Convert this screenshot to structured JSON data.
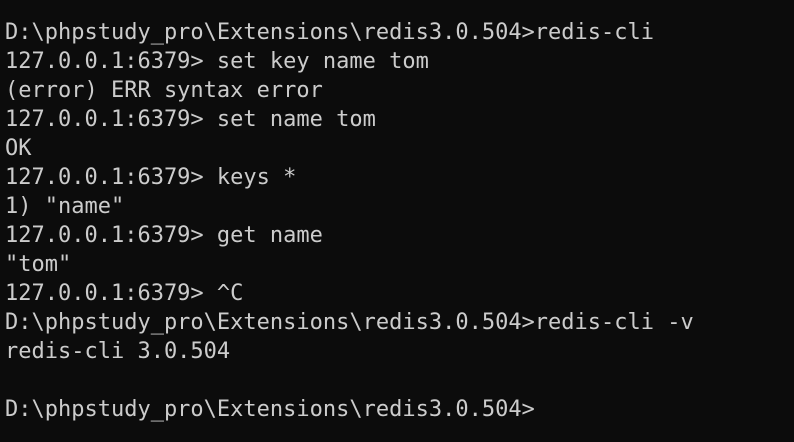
{
  "terminal": {
    "lines": [
      "D:\\phpstudy_pro\\Extensions\\redis3.0.504>redis-cli",
      "127.0.0.1:6379> set key name tom",
      "(error) ERR syntax error",
      "127.0.0.1:6379> set name tom",
      "OK",
      "127.0.0.1:6379> keys *",
      "1) \"name\"",
      "127.0.0.1:6379> get name",
      "\"tom\"",
      "127.0.0.1:6379> ^C",
      "D:\\phpstudy_pro\\Extensions\\redis3.0.504>redis-cli -v",
      "redis-cli 3.0.504",
      "",
      "D:\\phpstudy_pro\\Extensions\\redis3.0.504>"
    ]
  },
  "colors": {
    "background": "#0c0c0c",
    "text": "#cccccc"
  }
}
